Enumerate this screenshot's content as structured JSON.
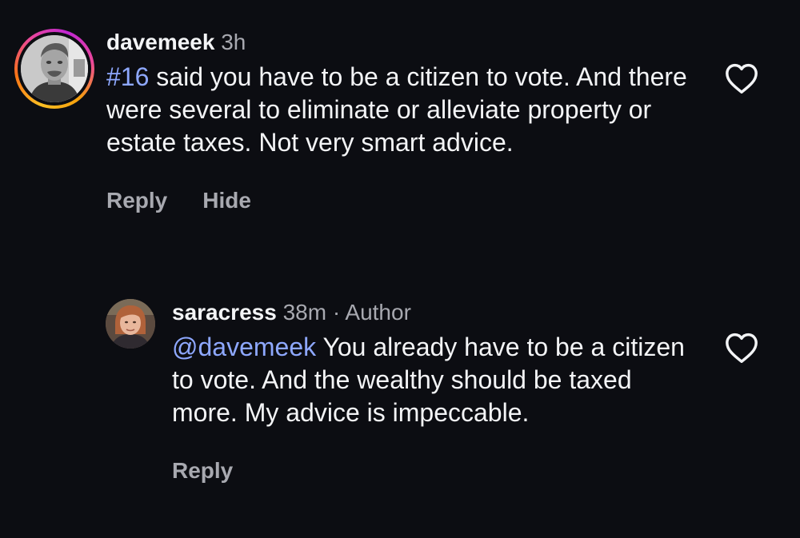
{
  "comments": [
    {
      "username": "davemeek",
      "time": "3h",
      "mention": "#16",
      "text": " said you have to be a citizen to vote. And there were several to eliminate or alleviate property or estate taxes. Not very smart advice.",
      "actions": {
        "reply": "Reply",
        "hide": "Hide"
      },
      "avatar_ring": true,
      "like_icon": "heart-outline-icon"
    },
    {
      "username": "saracress",
      "time": "38m",
      "separator": "·",
      "badge": "Author",
      "mention": "@davemeek",
      "text": " You already have to be a citizen to vote. And the wealthy should be taxed more. My advice is impeccable.",
      "actions": {
        "reply": "Reply"
      },
      "avatar_ring": false,
      "like_icon": "heart-outline-icon"
    }
  ],
  "colors": {
    "background": "#0c0d12",
    "text": "#f3f4f6",
    "muted": "#a8a9b0",
    "mention": "#8ea8ff"
  }
}
